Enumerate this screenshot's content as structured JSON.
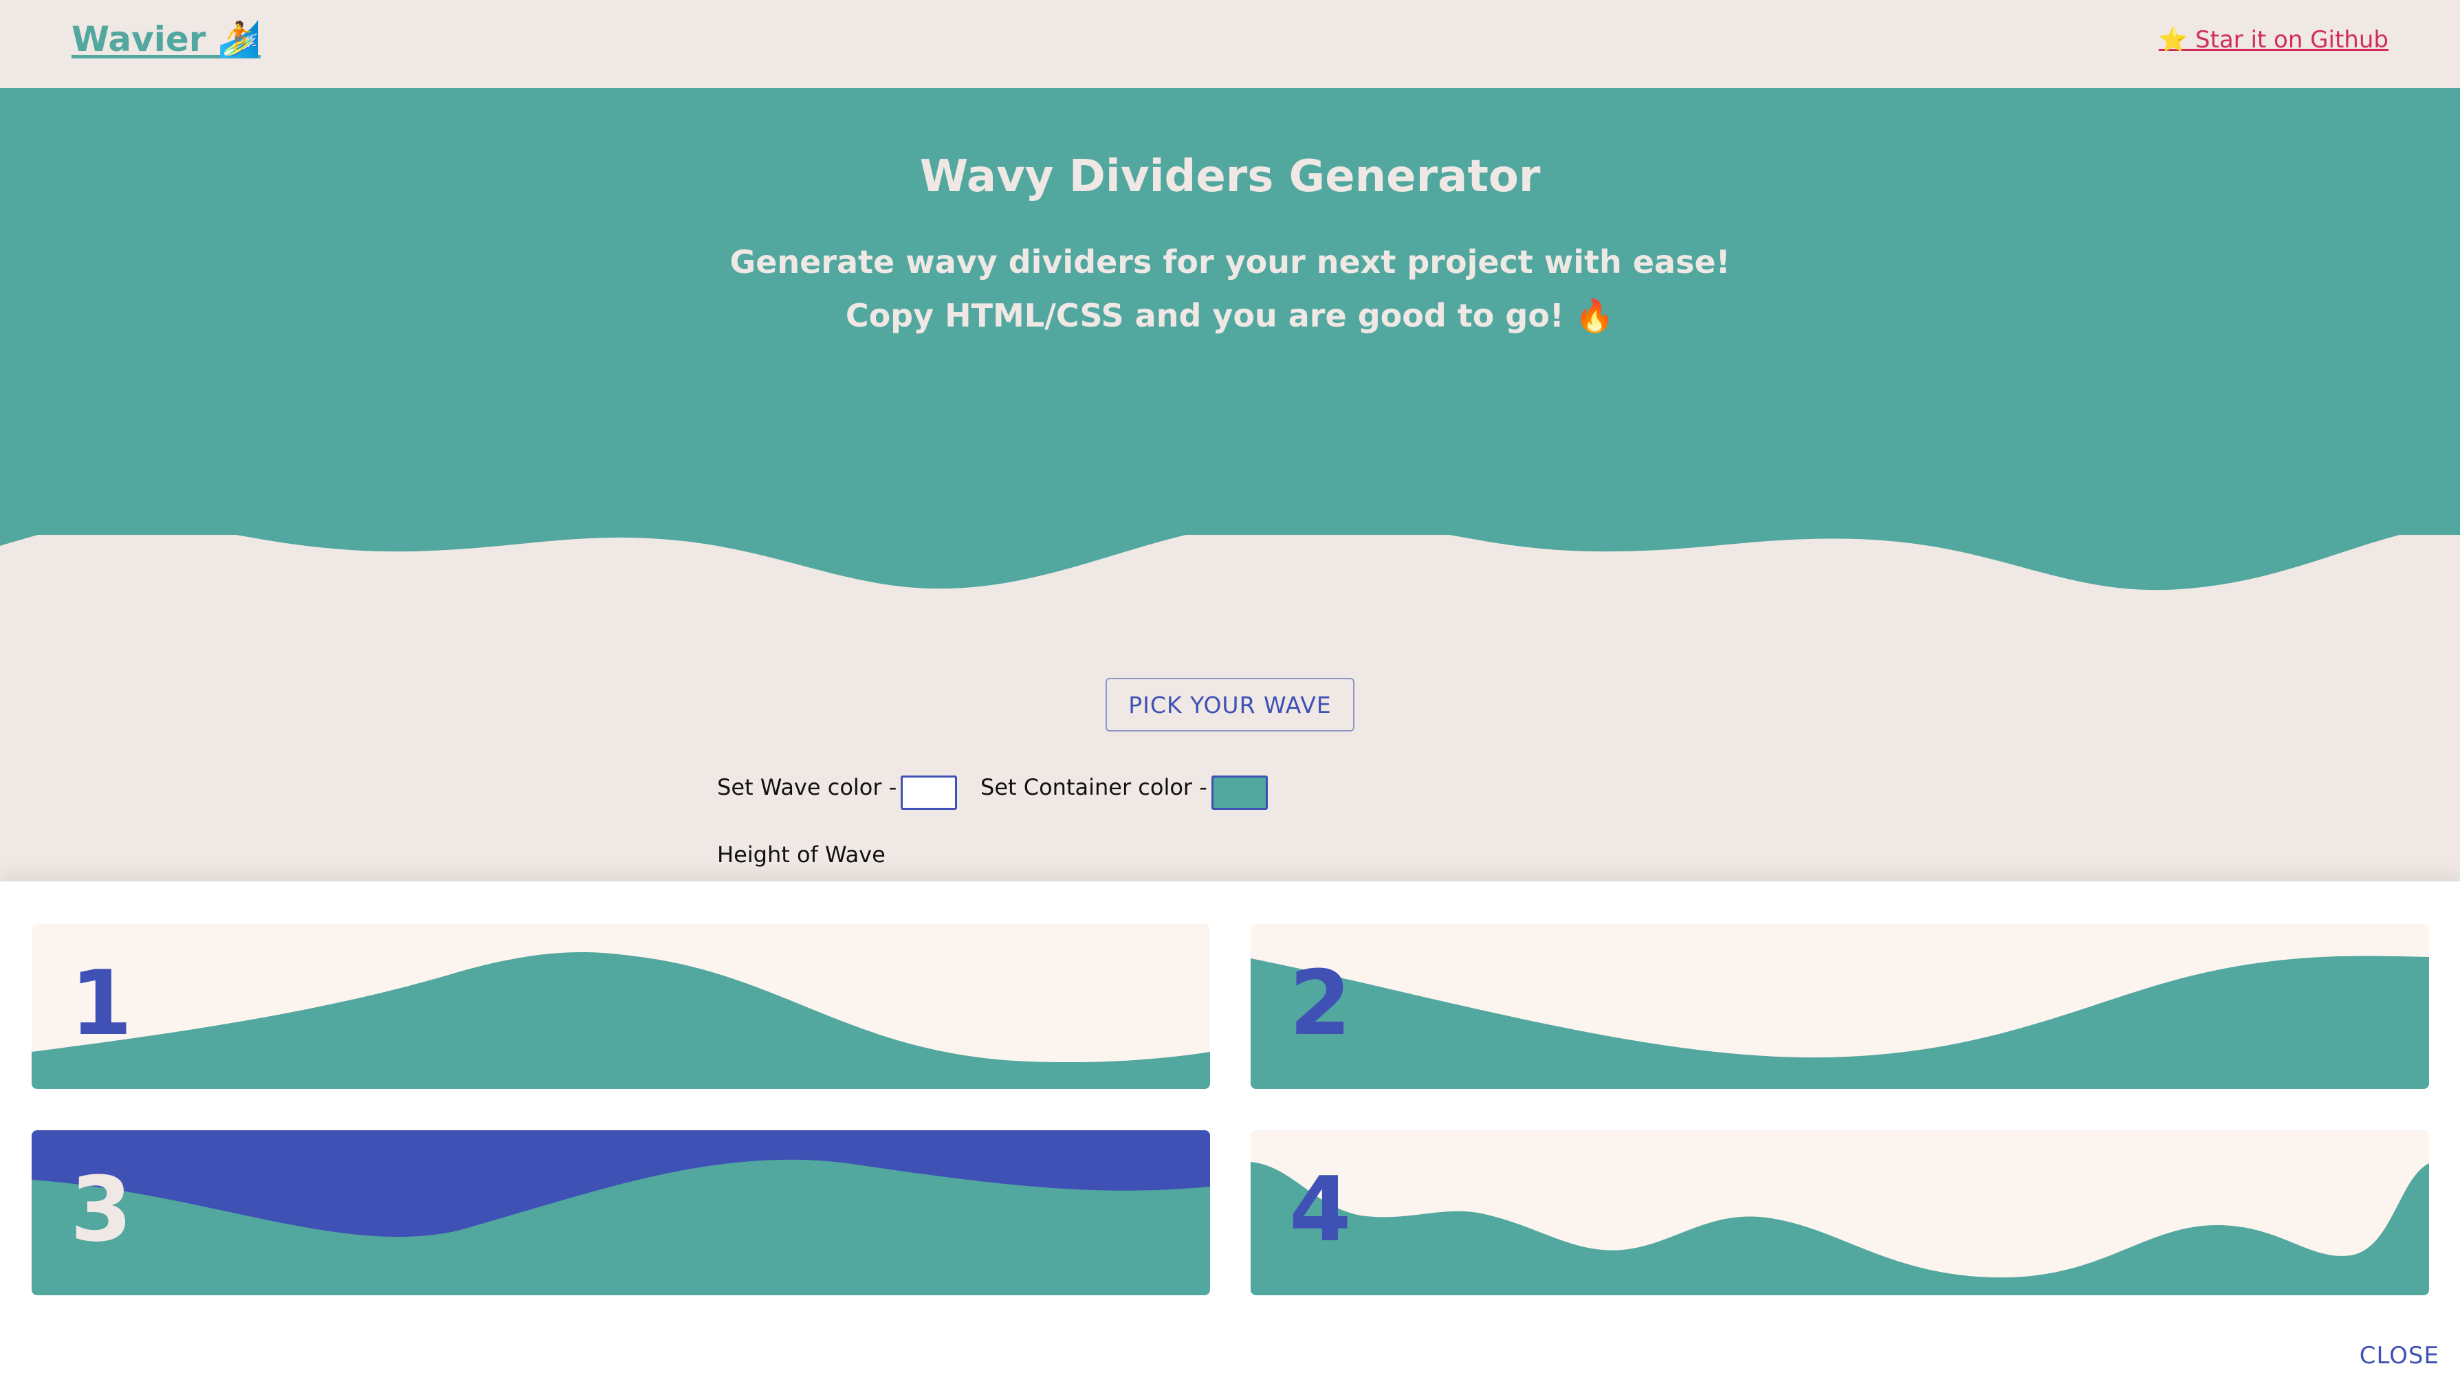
{
  "nav": {
    "logo": "Wavier 🏄",
    "github": "⭐ Star it on Github"
  },
  "hero": {
    "title": "Wavy Dividers Generator",
    "subtitle_line1": "Generate wavy dividers for your next project with ease!",
    "subtitle_line2": "Copy HTML/CSS and you are good to go! 🔥"
  },
  "controls": {
    "pick_button": "PICK YOUR WAVE",
    "wave_color_label": "Set Wave color -",
    "container_color_label": "Set Container color -",
    "height_label": "Height of Wave",
    "wave_color": "#FFFFFF",
    "container_color": "#52A79F"
  },
  "modal": {
    "cards": [
      {
        "number": "1"
      },
      {
        "number": "2"
      },
      {
        "number": "3"
      },
      {
        "number": "4"
      }
    ],
    "close": "CLOSE"
  },
  "colors": {
    "teal": "#52A79F",
    "cream": "#F0E8E4",
    "indigo": "#3F51B5",
    "card_bg": "#FCF4EF",
    "github": "#D12D5A"
  }
}
